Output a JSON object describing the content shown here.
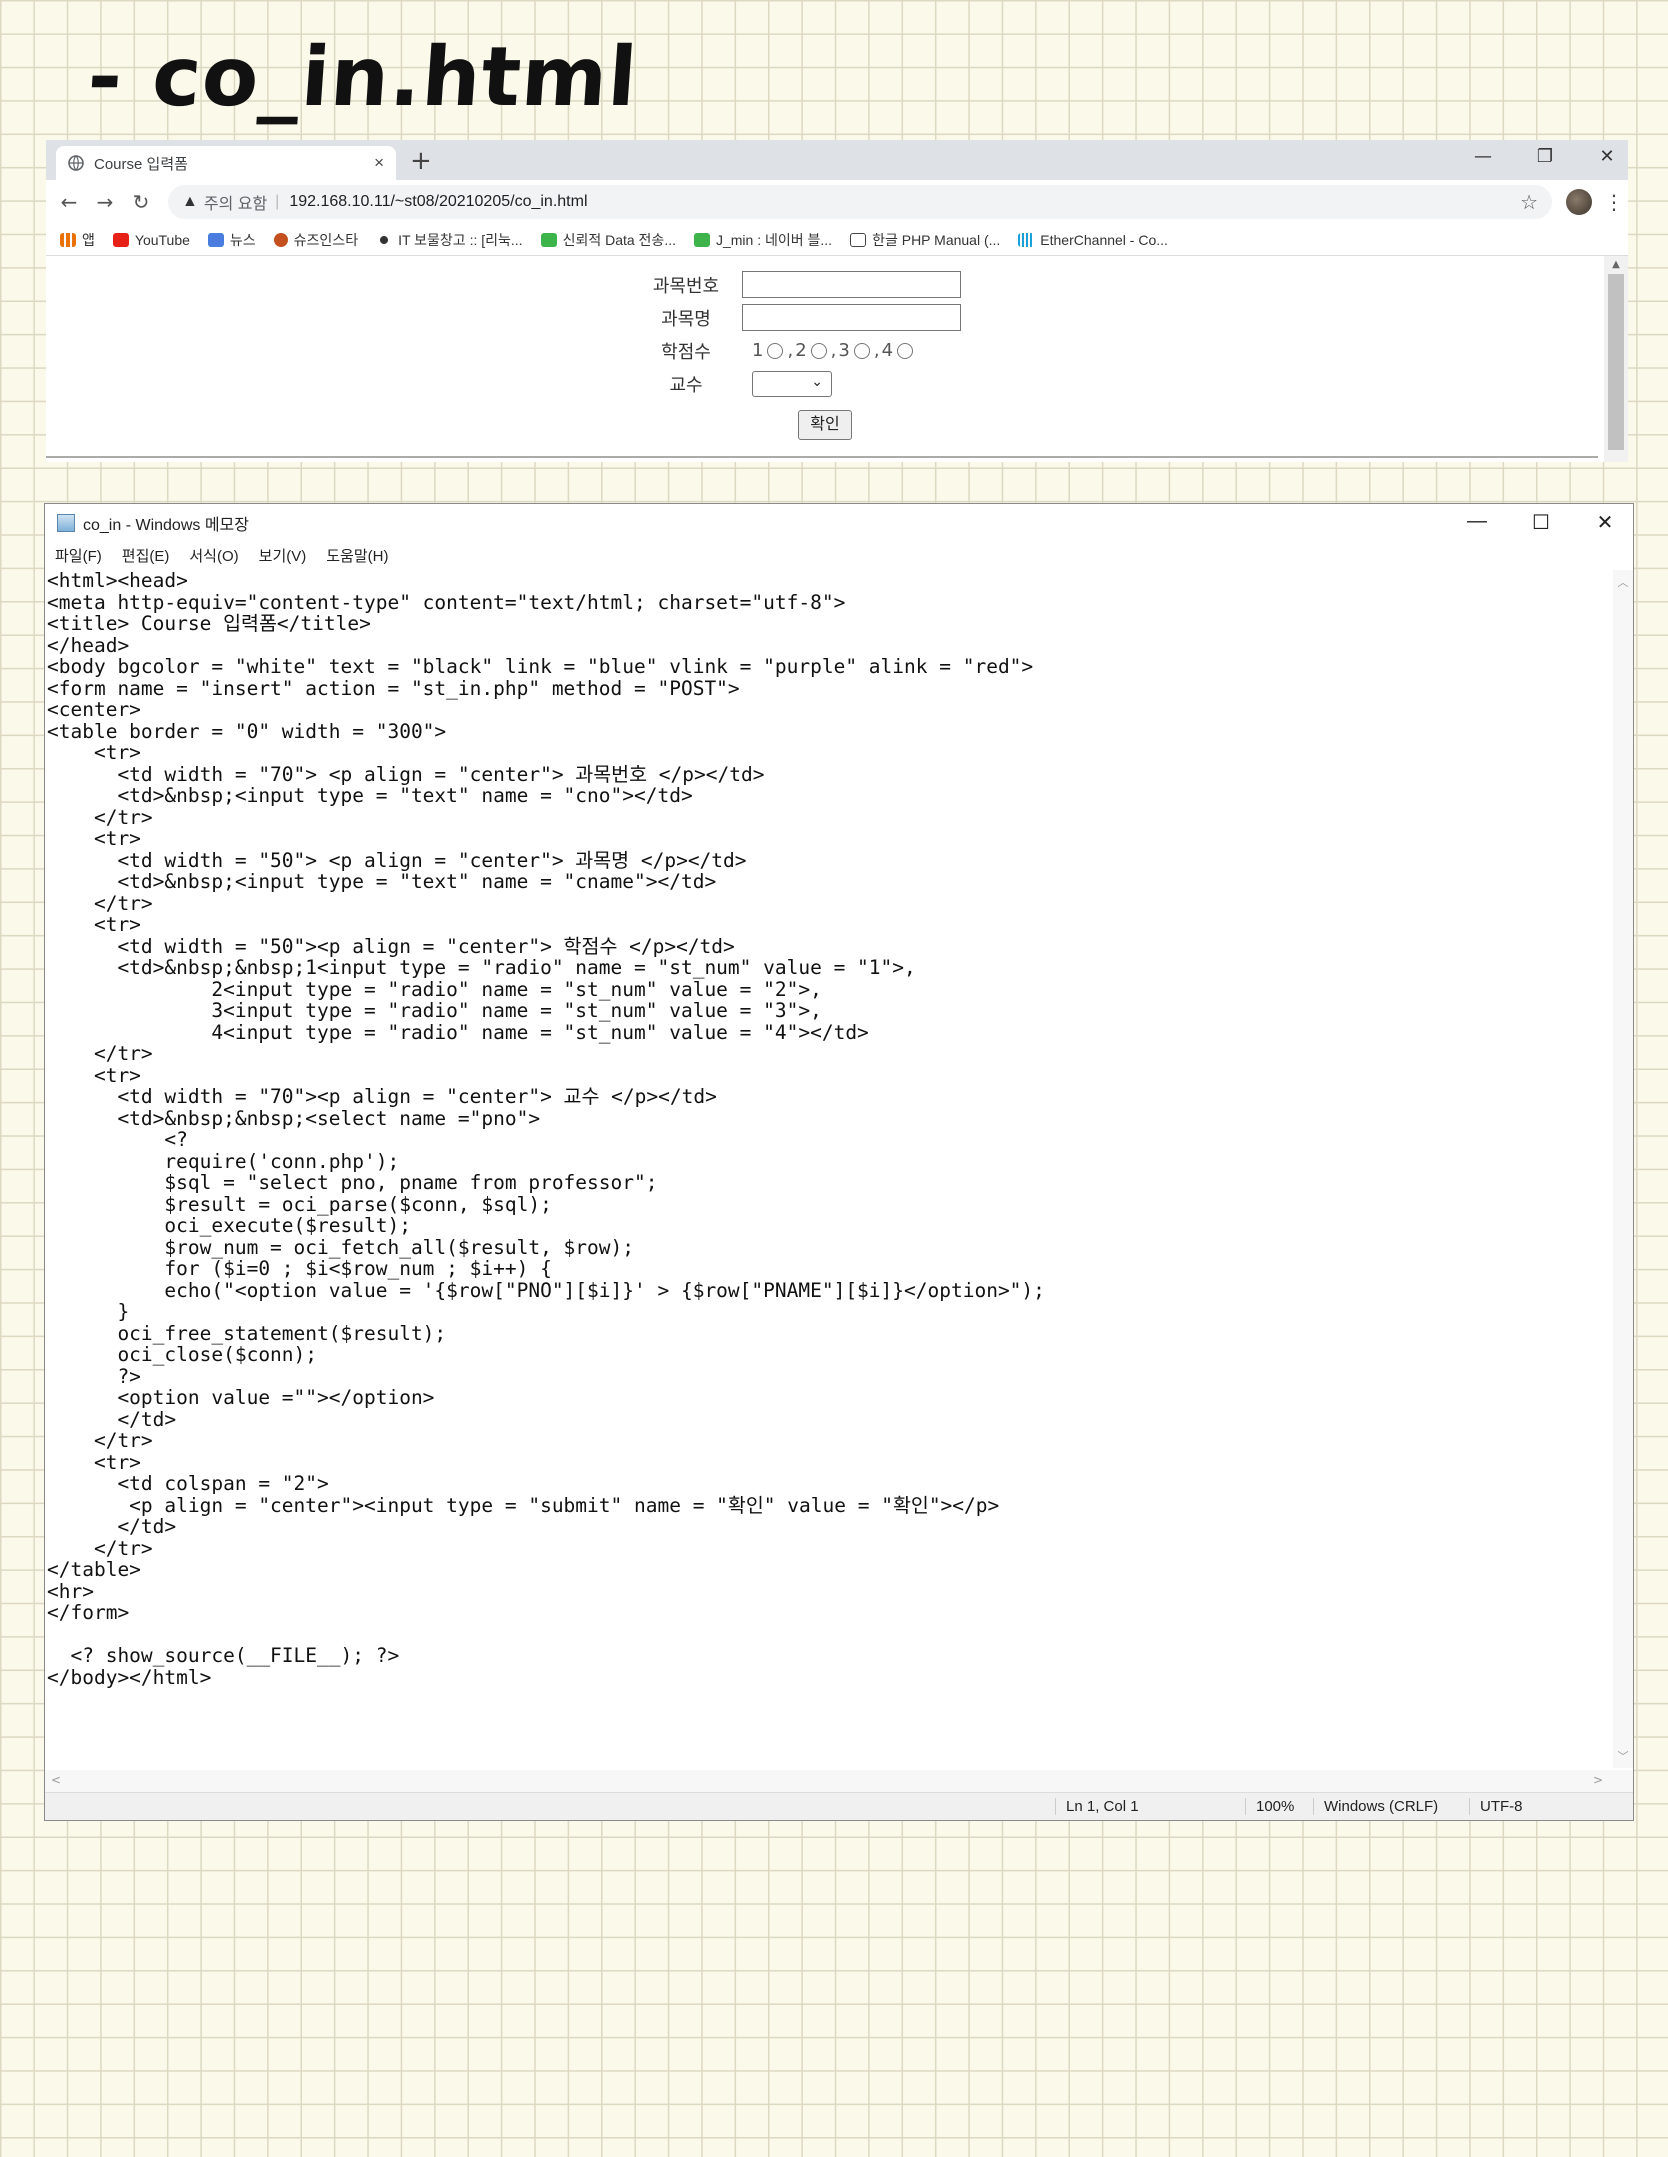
{
  "heading": "- co_in.html",
  "browser": {
    "tab_title": "Course 입력폼",
    "tab_close": "×",
    "new_tab": "+",
    "warning_text": "주의 요함",
    "url": "192.168.10.11/~st08/20210205/co_in.html",
    "bookmarks": [
      "앱",
      "YouTube",
      "뉴스",
      "슈즈인스타",
      "IT 보물창고 :: [리눅...",
      "신뢰적 Data 전송...",
      "J_min : 네이버 블...",
      "한글 PHP Manual (...",
      "EtherChannel - Co..."
    ],
    "form": {
      "labels": [
        "과목번호",
        "과목명",
        "학점수",
        "교수"
      ],
      "radio_values": [
        "1",
        "2",
        "3",
        "4"
      ],
      "submit_label": "확인"
    }
  },
  "notepad": {
    "title": "co_in - Windows 메모장",
    "menu": [
      "파일(F)",
      "편집(E)",
      "서식(O)",
      "보기(V)",
      "도움말(H)"
    ],
    "code_lines": [
      "<html><head>",
      "<meta http-equiv=\"content-type\" content=\"text/html; charset=\"utf-8\">",
      "<title> Course 입력폼</title>",
      "</head>",
      "<body bgcolor = \"white\" text = \"black\" link = \"blue\" vlink = \"purple\" alink = \"red\">",
      "<form name = \"insert\" action = \"st_in.php\" method = \"POST\">",
      "<center>",
      "<table border = \"0\" width = \"300\">",
      "    <tr>",
      "      <td width = \"70\"> <p align = \"center\"> 과목번호 </p></td>",
      "      <td>&nbsp;<input type = \"text\" name = \"cno\"></td>",
      "    </tr>",
      "    <tr>",
      "      <td width = \"50\"> <p align = \"center\"> 과목명 </p></td>",
      "      <td>&nbsp;<input type = \"text\" name = \"cname\"></td>",
      "    </tr>",
      "    <tr>",
      "      <td width = \"50\"><p align = \"center\"> 학점수 </p></td>",
      "      <td>&nbsp;&nbsp;1<input type = \"radio\" name = \"st_num\" value = \"1\">,",
      "              2<input type = \"radio\" name = \"st_num\" value = \"2\">,",
      "              3<input type = \"radio\" name = \"st_num\" value = \"3\">,",
      "              4<input type = \"radio\" name = \"st_num\" value = \"4\"></td>",
      "    </tr>",
      "    <tr>",
      "      <td width = \"70\"><p align = \"center\"> 교수 </p></td>",
      "      <td>&nbsp;&nbsp;<select name =\"pno\">",
      "          <?",
      "          require('conn.php');",
      "          $sql = \"select pno, pname from professor\";",
      "          $result = oci_parse($conn, $sql);",
      "          oci_execute($result);",
      "          $row_num = oci_fetch_all($result, $row);",
      "          for ($i=0 ; $i<$row_num ; $i++) {",
      "          echo(\"<option value = '{$row[\"PNO\"][$i]}' > {$row[\"PNAME\"][$i]}</option>\");",
      "      }",
      "      oci_free_statement($result);",
      "      oci_close($conn);",
      "      ?>",
      "      <option value =\"\"></option>",
      "      </td>",
      "    </tr>",
      "    <tr>",
      "      <td colspan = \"2\">",
      "       <p align = \"center\"><input type = \"submit\" name = \"확인\" value = \"확인\"></p>",
      "      </td>",
      "    </tr>",
      "</table>",
      "<hr>",
      "</form>",
      "",
      "  <? show_source(__FILE__); ?>",
      "</body></html>"
    ],
    "status": {
      "position": "Ln 1, Col 1",
      "zoom": "100%",
      "line_ending": "Windows (CRLF)",
      "encoding": "UTF-8"
    }
  }
}
